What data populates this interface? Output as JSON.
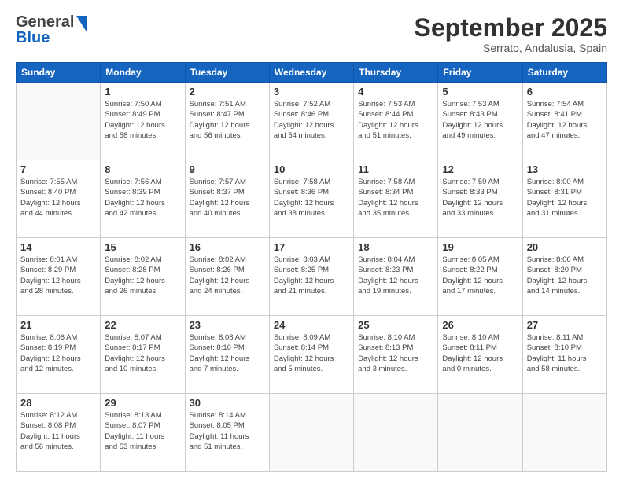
{
  "header": {
    "logo_line1": "General",
    "logo_line2": "Blue",
    "month_title": "September 2025",
    "location": "Serrato, Andalusia, Spain"
  },
  "weekdays": [
    "Sunday",
    "Monday",
    "Tuesday",
    "Wednesday",
    "Thursday",
    "Friday",
    "Saturday"
  ],
  "weeks": [
    [
      {
        "day": "",
        "info": ""
      },
      {
        "day": "1",
        "info": "Sunrise: 7:50 AM\nSunset: 8:49 PM\nDaylight: 12 hours\nand 58 minutes."
      },
      {
        "day": "2",
        "info": "Sunrise: 7:51 AM\nSunset: 8:47 PM\nDaylight: 12 hours\nand 56 minutes."
      },
      {
        "day": "3",
        "info": "Sunrise: 7:52 AM\nSunset: 8:46 PM\nDaylight: 12 hours\nand 54 minutes."
      },
      {
        "day": "4",
        "info": "Sunrise: 7:53 AM\nSunset: 8:44 PM\nDaylight: 12 hours\nand 51 minutes."
      },
      {
        "day": "5",
        "info": "Sunrise: 7:53 AM\nSunset: 8:43 PM\nDaylight: 12 hours\nand 49 minutes."
      },
      {
        "day": "6",
        "info": "Sunrise: 7:54 AM\nSunset: 8:41 PM\nDaylight: 12 hours\nand 47 minutes."
      }
    ],
    [
      {
        "day": "7",
        "info": "Sunrise: 7:55 AM\nSunset: 8:40 PM\nDaylight: 12 hours\nand 44 minutes."
      },
      {
        "day": "8",
        "info": "Sunrise: 7:56 AM\nSunset: 8:39 PM\nDaylight: 12 hours\nand 42 minutes."
      },
      {
        "day": "9",
        "info": "Sunrise: 7:57 AM\nSunset: 8:37 PM\nDaylight: 12 hours\nand 40 minutes."
      },
      {
        "day": "10",
        "info": "Sunrise: 7:58 AM\nSunset: 8:36 PM\nDaylight: 12 hours\nand 38 minutes."
      },
      {
        "day": "11",
        "info": "Sunrise: 7:58 AM\nSunset: 8:34 PM\nDaylight: 12 hours\nand 35 minutes."
      },
      {
        "day": "12",
        "info": "Sunrise: 7:59 AM\nSunset: 8:33 PM\nDaylight: 12 hours\nand 33 minutes."
      },
      {
        "day": "13",
        "info": "Sunrise: 8:00 AM\nSunset: 8:31 PM\nDaylight: 12 hours\nand 31 minutes."
      }
    ],
    [
      {
        "day": "14",
        "info": "Sunrise: 8:01 AM\nSunset: 8:29 PM\nDaylight: 12 hours\nand 28 minutes."
      },
      {
        "day": "15",
        "info": "Sunrise: 8:02 AM\nSunset: 8:28 PM\nDaylight: 12 hours\nand 26 minutes."
      },
      {
        "day": "16",
        "info": "Sunrise: 8:02 AM\nSunset: 8:26 PM\nDaylight: 12 hours\nand 24 minutes."
      },
      {
        "day": "17",
        "info": "Sunrise: 8:03 AM\nSunset: 8:25 PM\nDaylight: 12 hours\nand 21 minutes."
      },
      {
        "day": "18",
        "info": "Sunrise: 8:04 AM\nSunset: 8:23 PM\nDaylight: 12 hours\nand 19 minutes."
      },
      {
        "day": "19",
        "info": "Sunrise: 8:05 AM\nSunset: 8:22 PM\nDaylight: 12 hours\nand 17 minutes."
      },
      {
        "day": "20",
        "info": "Sunrise: 8:06 AM\nSunset: 8:20 PM\nDaylight: 12 hours\nand 14 minutes."
      }
    ],
    [
      {
        "day": "21",
        "info": "Sunrise: 8:06 AM\nSunset: 8:19 PM\nDaylight: 12 hours\nand 12 minutes."
      },
      {
        "day": "22",
        "info": "Sunrise: 8:07 AM\nSunset: 8:17 PM\nDaylight: 12 hours\nand 10 minutes."
      },
      {
        "day": "23",
        "info": "Sunrise: 8:08 AM\nSunset: 8:16 PM\nDaylight: 12 hours\nand 7 minutes."
      },
      {
        "day": "24",
        "info": "Sunrise: 8:09 AM\nSunset: 8:14 PM\nDaylight: 12 hours\nand 5 minutes."
      },
      {
        "day": "25",
        "info": "Sunrise: 8:10 AM\nSunset: 8:13 PM\nDaylight: 12 hours\nand 3 minutes."
      },
      {
        "day": "26",
        "info": "Sunrise: 8:10 AM\nSunset: 8:11 PM\nDaylight: 12 hours\nand 0 minutes."
      },
      {
        "day": "27",
        "info": "Sunrise: 8:11 AM\nSunset: 8:10 PM\nDaylight: 11 hours\nand 58 minutes."
      }
    ],
    [
      {
        "day": "28",
        "info": "Sunrise: 8:12 AM\nSunset: 8:08 PM\nDaylight: 11 hours\nand 56 minutes."
      },
      {
        "day": "29",
        "info": "Sunrise: 8:13 AM\nSunset: 8:07 PM\nDaylight: 11 hours\nand 53 minutes."
      },
      {
        "day": "30",
        "info": "Sunrise: 8:14 AM\nSunset: 8:05 PM\nDaylight: 11 hours\nand 51 minutes."
      },
      {
        "day": "",
        "info": ""
      },
      {
        "day": "",
        "info": ""
      },
      {
        "day": "",
        "info": ""
      },
      {
        "day": "",
        "info": ""
      }
    ]
  ]
}
